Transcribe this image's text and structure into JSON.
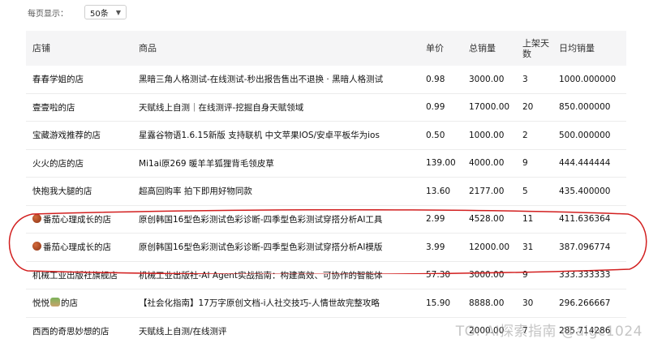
{
  "page_size": {
    "label": "每页显示：",
    "value": "50条"
  },
  "headers": {
    "shop": "店铺",
    "product": "商品",
    "price": "单价",
    "total_sales": "总销量",
    "days_line1": "上架天",
    "days_line2": "数",
    "daily_avg": "日均销量"
  },
  "rows": [
    {
      "shop": "春春学姐的店",
      "product": "黑暗三角人格测试-在线测试-秒出报告售出不退换 · 黑暗人格测试",
      "price": "0.98",
      "total_sales": "3000.00",
      "days": "3",
      "daily_avg": "1000.000000"
    },
    {
      "shop": "壹壹啦的店",
      "product": "天赋线上自测｜在线测评-挖掘自身天赋领域",
      "price": "0.99",
      "total_sales": "17000.00",
      "days": "20",
      "daily_avg": "850.000000"
    },
    {
      "shop": "宝藏游戏推荐的店",
      "product": "星露谷物语1.6.15新版 支持联机 中文苹果IOS/安卓平板华为ios",
      "price": "0.50",
      "total_sales": "1000.00",
      "days": "2",
      "daily_avg": "500.000000"
    },
    {
      "shop": "火火的店的店",
      "product": "Mi1ai原269 暖羊羊狐狸背毛领皮草",
      "price": "139.00",
      "total_sales": "4000.00",
      "days": "9",
      "daily_avg": "444.444444"
    },
    {
      "shop": "快抱我大腿的店",
      "product": "超高回购率 拍下即用好物同款",
      "price": "13.60",
      "total_sales": "2177.00",
      "days": "5",
      "daily_avg": "435.400000"
    },
    {
      "shop": "番茄心理成长的店",
      "product": "原创韩国16型色彩测试色彩诊断-四季型色彩测试穿搭分析AI工具",
      "price": "2.99",
      "total_sales": "4528.00",
      "days": "11",
      "daily_avg": "411.636364"
    },
    {
      "shop": "番茄心理成长的店",
      "product": "原创韩国16型色彩测试色彩诊断-四季型色彩测试穿搭分析AI模版",
      "price": "3.99",
      "total_sales": "12000.00",
      "days": "31",
      "daily_avg": "387.096774"
    },
    {
      "shop": "机械工业出版社旗舰店",
      "product": "机械工业出版社-AI Agent实战指南：构建高效、可协作的智能体",
      "price": "57.30",
      "total_sales": "3000.00",
      "days": "9",
      "daily_avg": "333.333333"
    },
    {
      "shop_prefix": "悦悦",
      "shop": "的店",
      "product": "【社会化指南】17万字原创文档-i人社交技巧-人情世故完整攻略",
      "price": "15.90",
      "total_sales": "8888.00",
      "days": "30",
      "daily_avg": "296.266667"
    },
    {
      "shop": "西西的奇思妙想的店",
      "product": "天赋线上自测/在线测评",
      "price": "",
      "total_sales": "2000.00",
      "days": "7",
      "daily_avg": "285.714286"
    }
  ],
  "watermark": "TG: AI探索指南 @aigc1024",
  "colors": {
    "highlight": "#d21f1f",
    "header_bg": "#f5f5f6"
  }
}
